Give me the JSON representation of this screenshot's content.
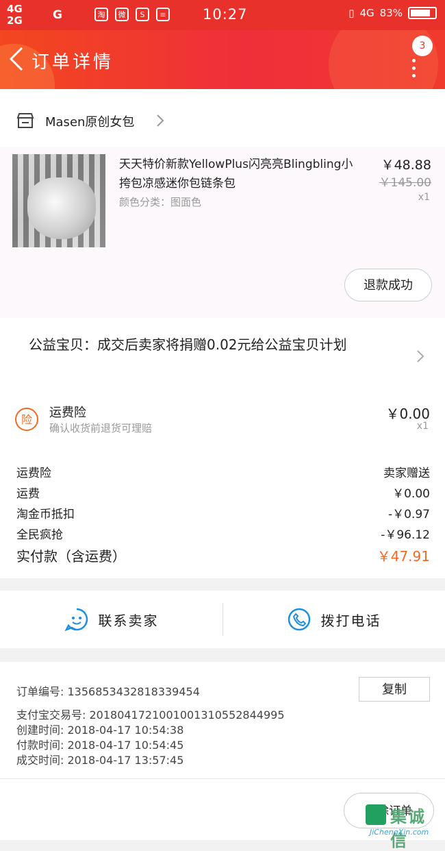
{
  "status_bar": {
    "network1": "4G",
    "network2": "2G",
    "network3": "G",
    "app_icons": [
      "淘",
      "微",
      "S",
      "≡"
    ],
    "time": "10:27",
    "signal_right": "4G",
    "battery": "83%",
    "battery_level": 0.83
  },
  "header": {
    "title": "订单详情",
    "badge_count": "3",
    "brand_color": "#e8312a"
  },
  "shop": {
    "name": "Masen原创女包"
  },
  "item": {
    "title": "天天特价新款YellowPlus闪亮亮Blingbling小挎包凉感迷你包链条包",
    "spec": "颜色分类：图面色",
    "price": "￥48.88",
    "original_price": "￥145.00",
    "quantity": "x1",
    "refund_status": "退款成功"
  },
  "charity": {
    "text": "公益宝贝：成交后卖家将捐赠0.02元给公益宝贝计划"
  },
  "insurance": {
    "icon_label": "险",
    "title": "运费险",
    "subtitle": "确认收货前退货可理赔",
    "price": "￥0.00",
    "quantity": "x1"
  },
  "costs": [
    {
      "label": "运费险",
      "value": "卖家赠送"
    },
    {
      "label": "运费",
      "value": "￥0.00"
    },
    {
      "label": "淘金币抵扣",
      "value": "-￥0.97"
    },
    {
      "label": "全民疯抢",
      "value": "-￥96.12"
    }
  ],
  "total": {
    "label": "实付款（含运费）",
    "value": "￥47.91",
    "accent": "#f06a1f"
  },
  "contact": {
    "seller": "联系卖家",
    "call": "拨打电话"
  },
  "order_info": {
    "order_no": "订单编号:  1356853432818339454",
    "copy": "复制",
    "alipay_no": "支付宝交易号:  2018041721001001310552844995",
    "created": "创建时间:   2018-04-17  10:54:38",
    "paid": "付款时间:   2018-04-17  10:54:45",
    "completed": "成交时间:   2018-04-17  13:57:45"
  },
  "bottom": {
    "delete": "删除订单"
  },
  "watermark": {
    "text": "集诚信",
    "url": "JiChengXin.com"
  }
}
